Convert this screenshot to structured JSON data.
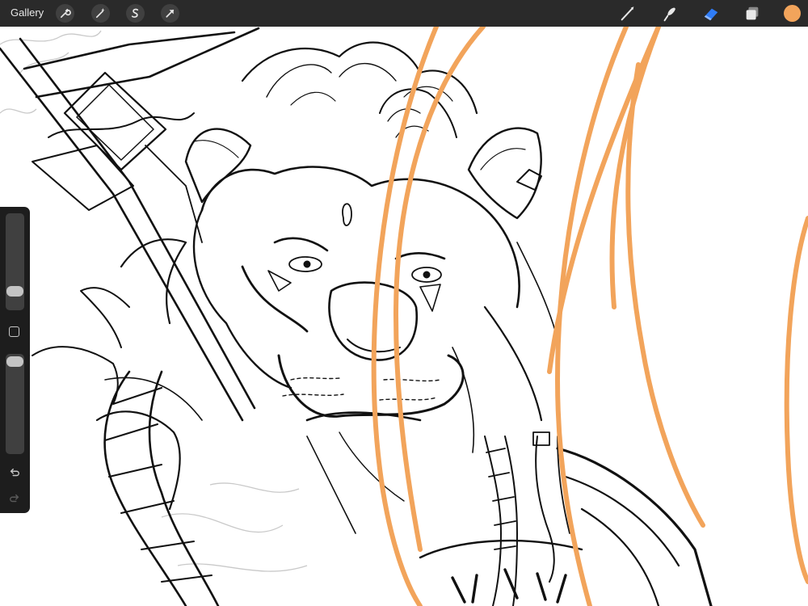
{
  "app": {
    "gallery_label": "Gallery"
  },
  "toolbar": {
    "left_actions": [
      {
        "name": "actions-wrench-icon"
      },
      {
        "name": "adjustments-wand-icon"
      },
      {
        "name": "selection-s-icon"
      },
      {
        "name": "transform-arrow-icon"
      }
    ],
    "right_tools": [
      {
        "name": "brush-icon"
      },
      {
        "name": "smudge-icon"
      },
      {
        "name": "eraser-icon"
      },
      {
        "name": "layers-icon"
      },
      {
        "name": "color-swatch"
      }
    ]
  },
  "colors": {
    "topbar": "#2a2a2a",
    "sidebar": "#1d1d1d",
    "active_color": "#f2a45b",
    "eraser_active": "#2f7cf6",
    "line_art": "#111111",
    "sketch_lines": "#c9c9c9"
  },
  "sidebar": {
    "brush_size_level": 0.24,
    "opacity_level": 0.92,
    "controls": [
      "size-slider",
      "modify-button",
      "opacity-slider",
      "undo-icon",
      "redo-icon"
    ]
  },
  "canvas": {
    "subject": "lion-warrior-line-art"
  }
}
